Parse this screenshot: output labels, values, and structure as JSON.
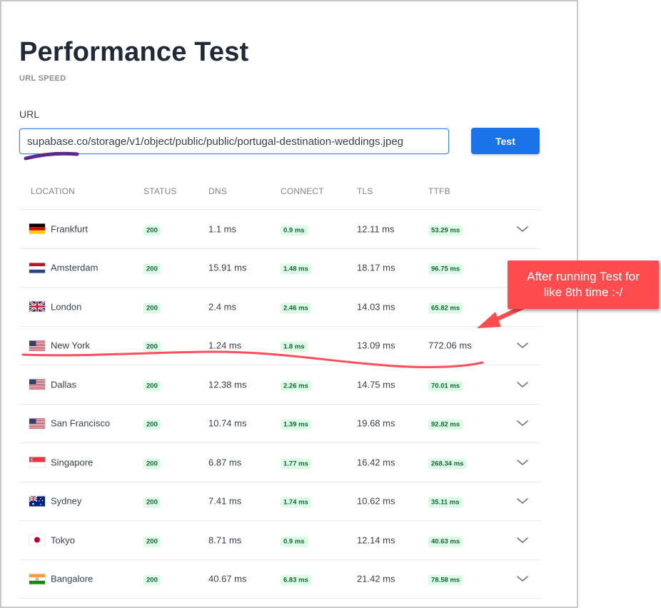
{
  "header": {
    "title": "Performance Test",
    "subtitle": "URL SPEED"
  },
  "form": {
    "url_label": "URL",
    "url_value": "supabase.co/storage/v1/object/public/public/portugal-destination-weddings.jpeg",
    "test_button": "Test"
  },
  "table": {
    "columns": {
      "location": "LOCATION",
      "status": "STATUS",
      "dns": "DNS",
      "connect": "CONNECT",
      "tls": "TLS",
      "ttfb": "TTFB"
    },
    "rows": [
      {
        "flag": "germany-flag-icon",
        "location": "Frankfurt",
        "status": "200",
        "dns": "1.1 ms",
        "connect": "0.9 ms",
        "tls": "12.11 ms",
        "ttfb": "53.29 ms",
        "ttfb_style": "badge"
      },
      {
        "flag": "netherlands-flag-icon",
        "location": "Amsterdam",
        "status": "200",
        "dns": "15.91 ms",
        "connect": "1.48 ms",
        "tls": "18.17 ms",
        "ttfb": "96.75 ms",
        "ttfb_style": "badge"
      },
      {
        "flag": "uk-flag-icon",
        "location": "London",
        "status": "200",
        "dns": "2.4 ms",
        "connect": "2.46 ms",
        "tls": "14.03 ms",
        "ttfb": "65.82 ms",
        "ttfb_style": "badge"
      },
      {
        "flag": "us-flag-icon",
        "location": "New York",
        "status": "200",
        "dns": "1.24 ms",
        "connect": "1.8 ms",
        "tls": "13.09 ms",
        "ttfb": "772.06 ms",
        "ttfb_style": "plain"
      },
      {
        "flag": "us-flag-icon",
        "location": "Dallas",
        "status": "200",
        "dns": "12.38 ms",
        "connect": "2.26 ms",
        "tls": "14.75 ms",
        "ttfb": "70.01 ms",
        "ttfb_style": "badge"
      },
      {
        "flag": "us-flag-icon",
        "location": "San Francisco",
        "status": "200",
        "dns": "10.74 ms",
        "connect": "1.39 ms",
        "tls": "19.68 ms",
        "ttfb": "92.82 ms",
        "ttfb_style": "badge"
      },
      {
        "flag": "singapore-flag-icon",
        "location": "Singapore",
        "status": "200",
        "dns": "6.87 ms",
        "connect": "1.77 ms",
        "tls": "16.42 ms",
        "ttfb": "268.34 ms",
        "ttfb_style": "badge"
      },
      {
        "flag": "australia-flag-icon",
        "location": "Sydney",
        "status": "200",
        "dns": "7.41 ms",
        "connect": "1.74 ms",
        "tls": "10.62 ms",
        "ttfb": "35.11 ms",
        "ttfb_style": "badge"
      },
      {
        "flag": "japan-flag-icon",
        "location": "Tokyo",
        "status": "200",
        "dns": "8.71 ms",
        "connect": "0.9 ms",
        "tls": "12.14 ms",
        "ttfb": "40.63 ms",
        "ttfb_style": "badge"
      },
      {
        "flag": "india-flag-icon",
        "location": "Bangalore",
        "status": "200",
        "dns": "40.67 ms",
        "connect": "6.83 ms",
        "tls": "21.42 ms",
        "ttfb": "78.58 ms",
        "ttfb_style": "badge"
      }
    ]
  },
  "annotation": {
    "line1": "After running Test for",
    "line2": "like 8th time :-/"
  },
  "colors": {
    "accent": "#1a73e8",
    "badge_bg": "#dcfce7",
    "badge_text": "#166534",
    "annotation": "#ff4d4f",
    "highlight_line": "#ff4d5a",
    "underline_mark": "#5b2a86"
  }
}
